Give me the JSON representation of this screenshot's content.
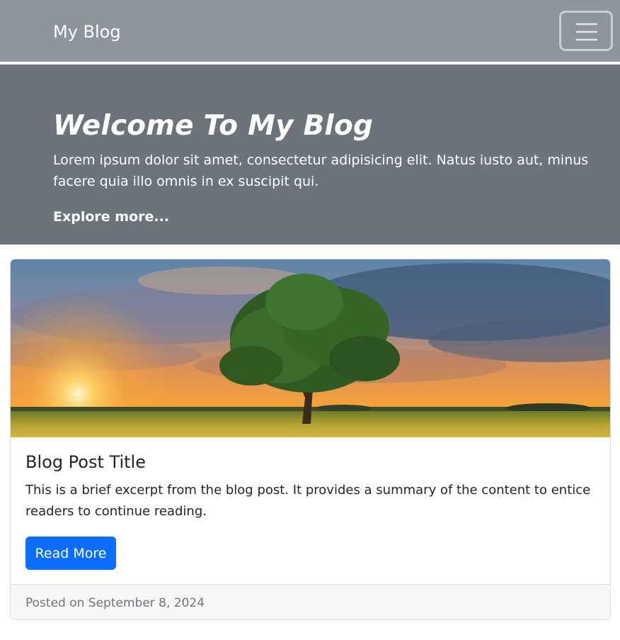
{
  "navbar": {
    "brand": "My Blog",
    "toggler_icon": "hamburger-menu-icon"
  },
  "hero": {
    "title": "Welcome To My Blog",
    "text": "Lorem ipsum dolor sit amet, consectetur adipisicing elit. Natus iusto aut, minus facere quia illo omnis in ex suscipit qui.",
    "link": "Explore more..."
  },
  "post": {
    "image": "sunset-tree-field-image",
    "title": "Blog Post Title",
    "excerpt": "This is a brief excerpt from the blog post. It provides a summary of the content to entice readers to continue reading.",
    "button": "Read More",
    "footer": "Posted on September 8, 2024"
  },
  "colors": {
    "navbar_bg": "#8e959c",
    "hero_bg": "#6c737b",
    "button_bg": "#0d6efd",
    "footer_bg": "#f7f7f7"
  }
}
